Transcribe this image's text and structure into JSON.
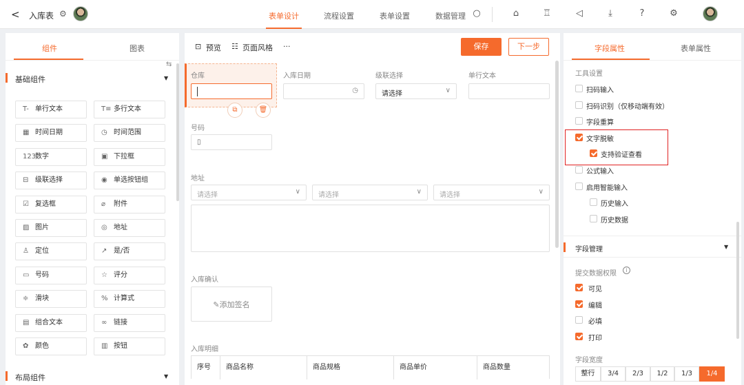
{
  "header": {
    "back": "<",
    "title": "入库表",
    "tabs": [
      "表单设计",
      "流程设置",
      "表单设置",
      "数据管理"
    ]
  },
  "left": {
    "tabs": [
      "组件",
      "图表"
    ],
    "section_basic": "基础组件",
    "section_layout": "布局组件",
    "components": [
      {
        "label": "单行文本",
        "icon": "T-"
      },
      {
        "label": "多行文本",
        "icon": "T≡"
      },
      {
        "label": "时间日期",
        "icon": "▦"
      },
      {
        "label": "时间范围",
        "icon": "◷"
      },
      {
        "label": "数字",
        "icon": "123"
      },
      {
        "label": "下拉框",
        "icon": "▣"
      },
      {
        "label": "级联选择",
        "icon": "⊟"
      },
      {
        "label": "单选按钮组",
        "icon": "◉"
      },
      {
        "label": "复选框",
        "icon": "☑"
      },
      {
        "label": "附件",
        "icon": "⌀"
      },
      {
        "label": "图片",
        "icon": "▨"
      },
      {
        "label": "地址",
        "icon": "◎"
      },
      {
        "label": "定位",
        "icon": "♙"
      },
      {
        "label": "是/否",
        "icon": "↗"
      },
      {
        "label": "号码",
        "icon": "▭"
      },
      {
        "label": "评分",
        "icon": "☆"
      },
      {
        "label": "滑块",
        "icon": "≑"
      },
      {
        "label": "计算式",
        "icon": "%"
      },
      {
        "label": "组合文本",
        "icon": "▤"
      },
      {
        "label": "链接",
        "icon": "∞"
      },
      {
        "label": "颜色",
        "icon": "✿"
      },
      {
        "label": "按钮",
        "icon": "▥"
      }
    ]
  },
  "center": {
    "preview": "预览",
    "style": "页面风格",
    "more": "···",
    "save": "保存",
    "next": "下一步",
    "field_warehouse": "仓库",
    "field_date": "入库日期",
    "field_cascade": "级联选择",
    "cascade_placeholder": "请选择",
    "field_text": "单行文本",
    "field_number": "号码",
    "field_address": "地址",
    "address_placeholder": "请选择",
    "field_confirm": "入库确认",
    "add_signature": "添加签名",
    "field_detail": "入库明细",
    "table_headers": [
      "序号",
      "商品名称",
      "商品规格",
      "商品单价",
      "商品数量"
    ]
  },
  "right": {
    "tabs": [
      "字段属性",
      "表单属性"
    ],
    "tool_title": "工具设置",
    "options": [
      {
        "label": "扫码输入",
        "checked": false,
        "indent": false
      },
      {
        "label": "扫码识别（仅移动端有效）",
        "checked": false,
        "indent": false
      },
      {
        "label": "字段重算",
        "checked": false,
        "indent": false
      },
      {
        "label": "文字脱敏",
        "checked": true,
        "indent": false
      },
      {
        "label": "支持验证查看",
        "checked": true,
        "indent": true
      },
      {
        "label": "公式输入",
        "checked": false,
        "indent": false
      },
      {
        "label": "启用智能输入",
        "checked": false,
        "indent": false
      },
      {
        "label": "历史输入",
        "checked": false,
        "indent": true
      },
      {
        "label": "历史数据",
        "checked": false,
        "indent": true
      }
    ],
    "field_manage": "字段管理",
    "perm_title": "提交数据权限",
    "perms": [
      {
        "label": "可见",
        "checked": true
      },
      {
        "label": "编辑",
        "checked": true
      },
      {
        "label": "必填",
        "checked": false
      },
      {
        "label": "打印",
        "checked": true
      }
    ],
    "width_title": "字段宽度",
    "widths": [
      "整行",
      "3/4",
      "2/3",
      "1/2",
      "1/3",
      "1/4"
    ],
    "width_selected": "1/4"
  },
  "colors": {
    "accent": "#f56a2c",
    "highlight_border": "#e02020"
  }
}
